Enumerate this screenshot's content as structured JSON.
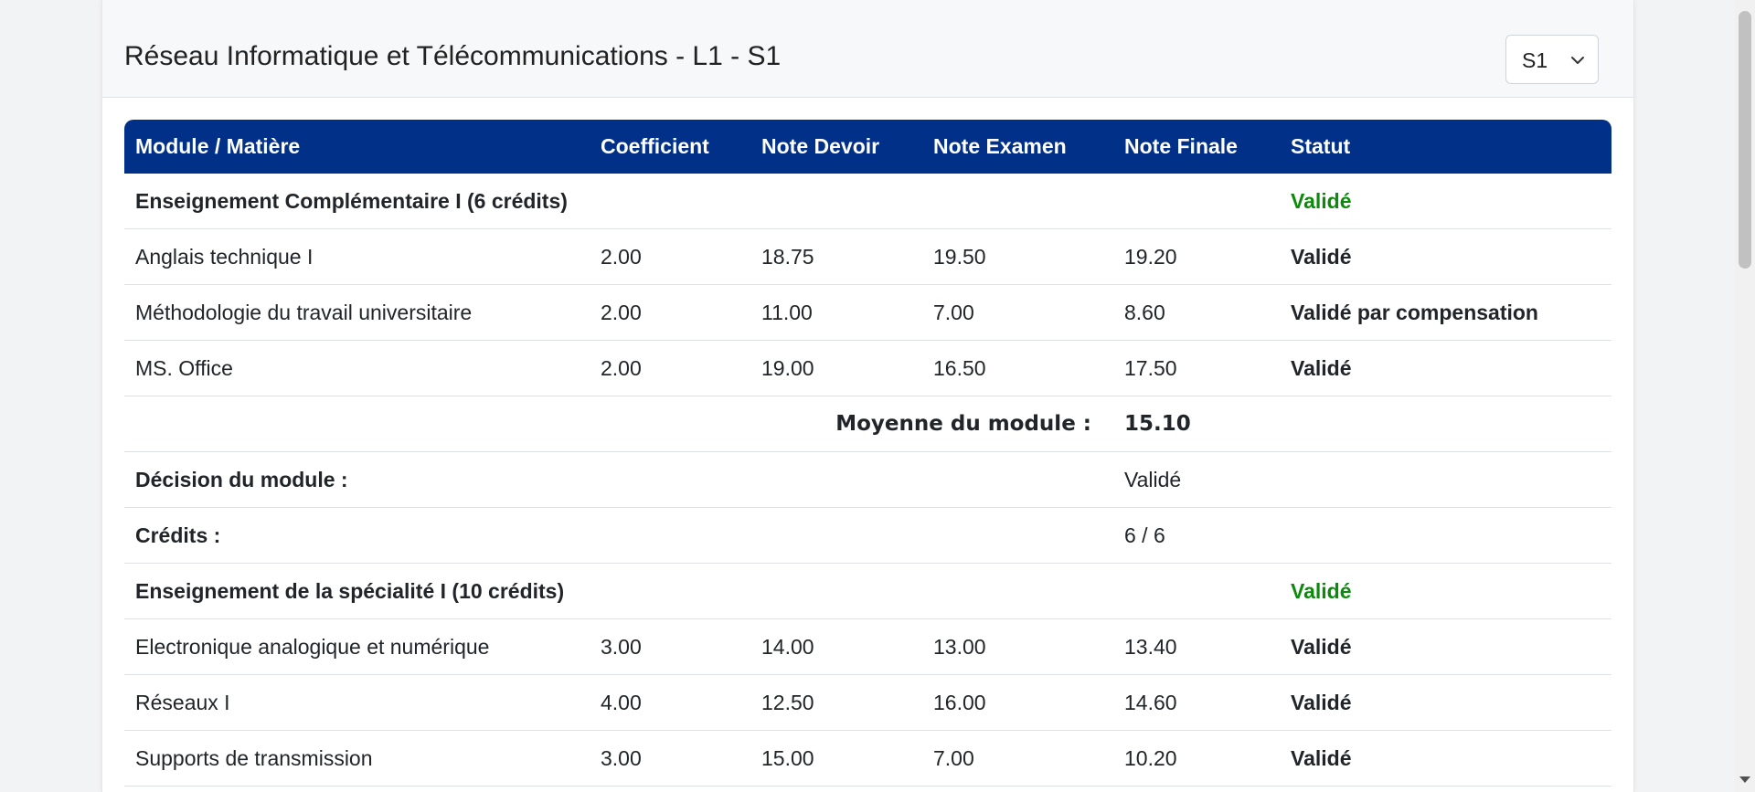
{
  "header": {
    "title": "Réseau Informatique et Télécommunications - L1 - S1",
    "semester_select": {
      "value": "S1",
      "icon": "chevron-down-icon"
    }
  },
  "table": {
    "columns": [
      "Module / Matière",
      "Coefficient",
      "Note Devoir",
      "Note Examen",
      "Note Finale",
      "Statut"
    ],
    "modules": [
      {
        "title": "Enseignement Complémentaire I (6 crédits)",
        "status": "Validé",
        "subjects": [
          {
            "name": "Anglais technique I",
            "coef": "2.00",
            "devoir": "18.75",
            "examen": "19.50",
            "finale": "19.20",
            "statut": "Validé"
          },
          {
            "name": "Méthodologie du travail universitaire",
            "coef": "2.00",
            "devoir": "11.00",
            "examen": "7.00",
            "finale": "8.60",
            "statut": "Validé par compensation"
          },
          {
            "name": "MS. Office",
            "coef": "2.00",
            "devoir": "19.00",
            "examen": "16.50",
            "finale": "17.50",
            "statut": "Validé"
          }
        ],
        "average_label": "Moyenne du module :",
        "average_value": "15.10",
        "decision_label": "Décision du module :",
        "decision_value": "Validé",
        "credits_label": "Crédits :",
        "credits_value": "6 / 6"
      },
      {
        "title": "Enseignement de la spécialité I (10 crédits)",
        "status": "Validé",
        "subjects": [
          {
            "name": "Electronique analogique et numérique",
            "coef": "3.00",
            "devoir": "14.00",
            "examen": "13.00",
            "finale": "13.40",
            "statut": "Validé"
          },
          {
            "name": "Réseaux I",
            "coef": "4.00",
            "devoir": "12.50",
            "examen": "16.00",
            "finale": "14.60",
            "statut": "Validé"
          },
          {
            "name": "Supports de transmission",
            "coef": "3.00",
            "devoir": "15.00",
            "examen": "7.00",
            "finale": "10.20",
            "statut": "Validé"
          }
        ]
      }
    ]
  },
  "colors": {
    "header_bg": "#003087",
    "validated_green": "#0b8a0b"
  }
}
